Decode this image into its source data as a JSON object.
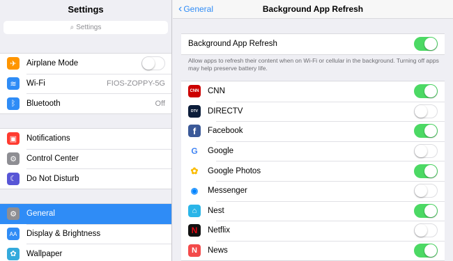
{
  "settings": {
    "title": "Settings",
    "search_placeholder": "Settings",
    "group1": [
      {
        "label": "Airplane Mode",
        "icon": "airplane-icon",
        "color": "#ff9500",
        "switch": false
      },
      {
        "label": "Wi-Fi",
        "icon": "wifi-icon",
        "color": "#2f8cf6",
        "value": "FIOS-ZOPPY-5G"
      },
      {
        "label": "Bluetooth",
        "icon": "bluetooth-icon",
        "color": "#2f8cf6",
        "value": "Off"
      }
    ],
    "group2": [
      {
        "label": "Notifications",
        "icon": "notifications-icon",
        "color": "#ff3b30"
      },
      {
        "label": "Control Center",
        "icon": "control-center-icon",
        "color": "#8e8e93"
      },
      {
        "label": "Do Not Disturb",
        "icon": "moon-icon",
        "color": "#5856d6"
      }
    ],
    "group3": [
      {
        "label": "General",
        "icon": "gear-icon",
        "color": "#8e8e93",
        "selected": true
      },
      {
        "label": "Display & Brightness",
        "icon": "display-icon",
        "color": "#2f8cf6"
      },
      {
        "label": "Wallpaper",
        "icon": "wallpaper-icon",
        "color": "#34aadc"
      }
    ]
  },
  "detail": {
    "back_label": "General",
    "title": "Background App Refresh",
    "master_label": "Background App Refresh",
    "master_on": true,
    "description": "Allow apps to refresh their content when on Wi-Fi or cellular in the background. Turning off apps may help preserve battery life.",
    "apps": [
      {
        "label": "CNN",
        "icon": "cnn-icon",
        "color": "#cc0000",
        "on": true,
        "badge": "CNN"
      },
      {
        "label": "DIRECTV",
        "icon": "directv-icon",
        "color": "#0c1d3a",
        "on": false,
        "badge": "DTV"
      },
      {
        "label": "Facebook",
        "icon": "facebook-icon",
        "color": "#3b5998",
        "on": true,
        "badge": "f"
      },
      {
        "label": "Google",
        "icon": "google-icon",
        "color": "#ffffff",
        "on": false,
        "badge": "G"
      },
      {
        "label": "Google Photos",
        "icon": "google-photos-icon",
        "color": "#ffffff",
        "on": true,
        "badge": "✿"
      },
      {
        "label": "Messenger",
        "icon": "messenger-icon",
        "color": "#ffffff",
        "on": false,
        "badge": "◉"
      },
      {
        "label": "Nest",
        "icon": "nest-icon",
        "color": "#2bb5e8",
        "on": true,
        "badge": "⌂"
      },
      {
        "label": "Netflix",
        "icon": "netflix-icon",
        "color": "#111111",
        "on": false,
        "badge": "N"
      },
      {
        "label": "News",
        "icon": "news-icon",
        "color": "#f34a4a",
        "on": true,
        "badge": "N"
      }
    ]
  }
}
